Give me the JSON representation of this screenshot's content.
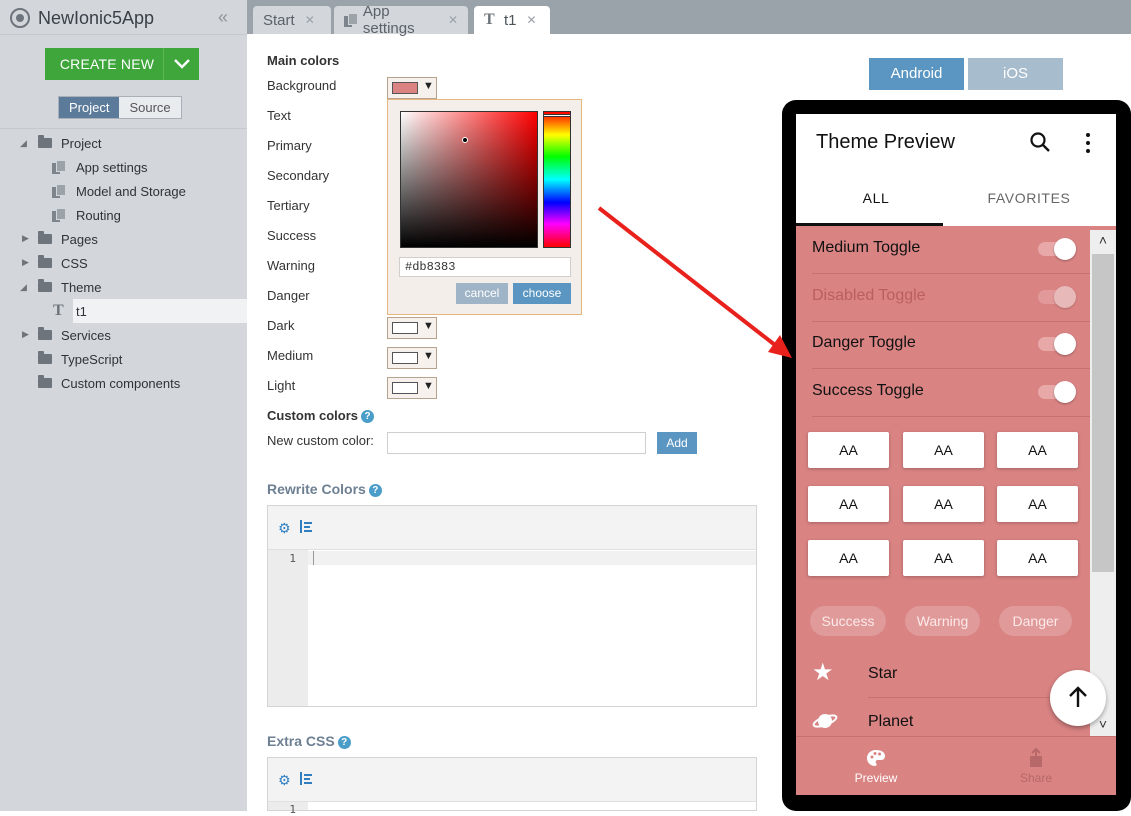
{
  "app": {
    "name": "NewIonic5App"
  },
  "sidebar": {
    "create_label": "CREATE NEW",
    "view_tabs": [
      "Project",
      "Source"
    ],
    "tree": [
      {
        "label": "Project",
        "type": "folder"
      },
      {
        "label": "App settings",
        "type": "file"
      },
      {
        "label": "Model and Storage",
        "type": "file"
      },
      {
        "label": "Routing",
        "type": "file"
      },
      {
        "label": "Pages",
        "type": "folder"
      },
      {
        "label": "CSS",
        "type": "folder"
      },
      {
        "label": "Theme",
        "type": "folder"
      },
      {
        "label": "t1",
        "type": "theme"
      },
      {
        "label": "Services",
        "type": "folder"
      },
      {
        "label": "TypeScript",
        "type": "folder"
      },
      {
        "label": "Custom components",
        "type": "folder"
      }
    ]
  },
  "tabs": [
    "Start",
    "App settings",
    "t1"
  ],
  "form": {
    "main_colors_title": "Main colors",
    "color_labels": [
      "Background",
      "Text",
      "Primary",
      "Secondary",
      "Tertiary",
      "Success",
      "Warning",
      "Danger",
      "Dark",
      "Medium",
      "Light"
    ],
    "custom_colors_title": "Custom colors",
    "new_custom_label": "New custom color:",
    "add_label": "Add",
    "rewrite_title": "Rewrite Colors",
    "extra_css_title": "Extra CSS",
    "line_numbers": [
      "1",
      "1"
    ]
  },
  "picker": {
    "hex": "#db8383",
    "cancel": "cancel",
    "choose": "choose"
  },
  "platform": {
    "android": "Android",
    "ios": "iOS"
  },
  "preview": {
    "title": "Theme Preview",
    "tabs": [
      "ALL",
      "FAVORITES"
    ],
    "toggles": [
      "Medium Toggle",
      "Disabled Toggle",
      "Danger Toggle",
      "Success Toggle"
    ],
    "buttons": [
      "AA",
      "AA",
      "AA",
      "AA",
      "AA",
      "AA",
      "AA",
      "AA",
      "AA"
    ],
    "chips": [
      "Success",
      "Warning",
      "Danger"
    ],
    "list": [
      "Star",
      "Planet"
    ],
    "bottom_tabs": [
      "Preview",
      "Share"
    ]
  },
  "colors": {
    "background": "#db8383",
    "sidebar": "#d3d7dc",
    "create_button": "#3fa63c",
    "accent_blue": "#5b96c2",
    "arrow": "#e8211c"
  },
  "icons": [
    "settings-icon",
    "indent-icon",
    "search-icon",
    "more-vertical-icon",
    "star-icon",
    "planet-icon",
    "arrow-up-icon",
    "palette-icon",
    "share-icon",
    "help-icon"
  ]
}
